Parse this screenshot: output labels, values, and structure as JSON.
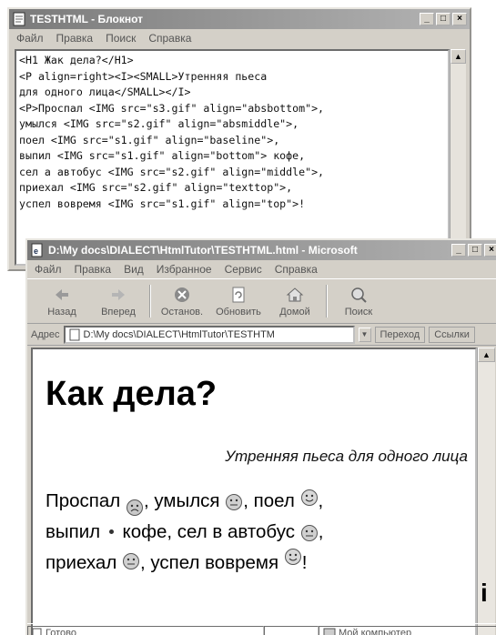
{
  "notepad": {
    "title": "TESTHTML - Блокнот",
    "menu": [
      "Файл",
      "Правка",
      "Поиск",
      "Справка"
    ],
    "lines": [
      "<H1 Жак дела?</H1>",
      "<P align=right><I><SMALL>Утренняя пьеса",
      "для одного лица</SMALL></I>",
      "<P>Проспал <IMG src=\"s3.gif\" align=\"absbottom\">,",
      "умылся <IMG src=\"s2.gif\" align=\"absmiddle\">,",
      "поел <IMG src=\"s1.gif\" align=\"baseline\">,",
      "выпил <IMG src=\"s1.gif\" align=\"bottom\"> кофе,",
      "сел а автобус <IMG src=\"s2.gif\" align=\"middle\">,",
      "приехал <IMG src=\"s2.gif\" align=\"texttop\">,",
      "успел вовремя <IMG src=\"s1.gif\" align=\"top\">!"
    ]
  },
  "browser": {
    "title": "D:\\My docs\\DIALECT\\HtmlTutor\\TESTHTML.html - Microsoft",
    "menu": [
      "Файл",
      "Правка",
      "Вид",
      "Избранное",
      "Сервис",
      "Справка"
    ],
    "toolbar": {
      "back": "Назад",
      "forward": "Вперед",
      "stop": "Останов.",
      "refresh": "Обновить",
      "home": "Домой",
      "search": "Поиск"
    },
    "address": {
      "label": "Адрес",
      "value": "D:\\My docs\\DIALECT\\HtmlTutor\\TESTHTM",
      "go": "Переход",
      "links": "Ссылки"
    },
    "page": {
      "heading": "Как дела?",
      "subtitle": "Утренняя пьеса для одного лица",
      "w1": "Проспал",
      "p1": ", умылся",
      "p2": ", поел",
      "p3": ",",
      "w4": "выпил",
      "p4": "кофе, сел в автобус",
      "p5": ",",
      "w6": "приехал",
      "p6": ", успел вовремя",
      "p7": "!"
    },
    "status": {
      "left": "Готово",
      "zone": "Мой компьютер"
    }
  },
  "cut_char": "i"
}
